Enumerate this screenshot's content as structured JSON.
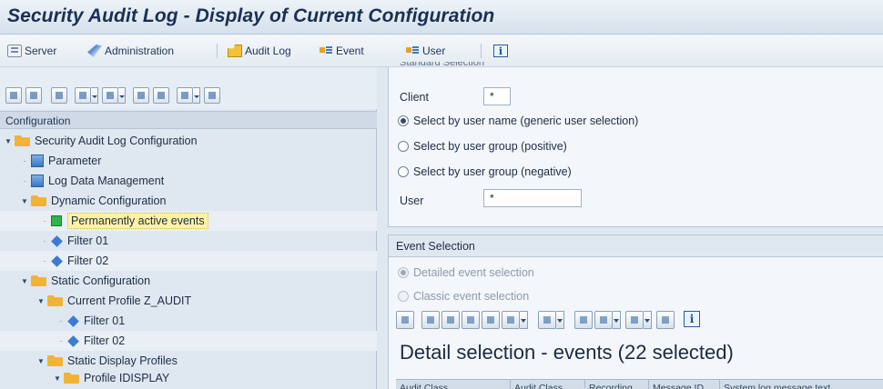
{
  "window": {
    "title": "Security Audit Log - Display of Current Configuration"
  },
  "app_toolbar": {
    "buttons": [
      {
        "label": "Server",
        "icon": "server-icon"
      },
      {
        "label": "Administration",
        "icon": "administration-icon"
      },
      {
        "label": "Audit Log",
        "icon": "audit-log-icon"
      },
      {
        "label": "Event",
        "icon": "event-icon"
      },
      {
        "label": "User",
        "icon": "user-icon"
      }
    ],
    "info_icon": "i"
  },
  "tree": {
    "header": "Configuration",
    "nodes": [
      {
        "label": "Security Audit Log Configuration",
        "icon": "folder-icon"
      },
      {
        "label": "Parameter",
        "icon": "parameter-icon"
      },
      {
        "label": "Log Data Management",
        "icon": "log-data-icon"
      },
      {
        "label": "Dynamic Configuration",
        "icon": "folder-icon"
      },
      {
        "label": "Permanently active events",
        "icon": "green-status-icon"
      },
      {
        "label": "Filter 01",
        "icon": "diamond-icon"
      },
      {
        "label": "Filter 02",
        "icon": "diamond-icon"
      },
      {
        "label": "Static Configuration",
        "icon": "folder-icon"
      },
      {
        "label": "Current Profile Z_AUDIT",
        "icon": "folder-icon"
      },
      {
        "label": "Filter 01",
        "icon": "diamond-icon"
      },
      {
        "label": "Filter 02",
        "icon": "diamond-icon"
      },
      {
        "label": "Static Display Profiles",
        "icon": "folder-icon"
      },
      {
        "label": "Profile IDISPLAY",
        "icon": "folder-icon"
      }
    ]
  },
  "standard_selection": {
    "title": "Standard Selection",
    "client_label": "Client",
    "client_value": "*",
    "radios": [
      {
        "label": "Select by user name (generic user selection)",
        "selected": true
      },
      {
        "label": "Select by user group (positive)",
        "selected": false
      },
      {
        "label": "Select by user group (negative)",
        "selected": false
      }
    ],
    "user_label": "User",
    "user_value": "*"
  },
  "event_selection": {
    "title": "Event Selection",
    "radios": [
      {
        "label": "Detailed event selection",
        "selected": true
      },
      {
        "label": "Classic event selection",
        "selected": false
      }
    ],
    "info_icon": "i",
    "detail_title": "Detail selection - events (22 selected)",
    "columns": [
      "Audit Class",
      "Audit Class",
      "Recording",
      "Message ID",
      "System log message text"
    ]
  }
}
